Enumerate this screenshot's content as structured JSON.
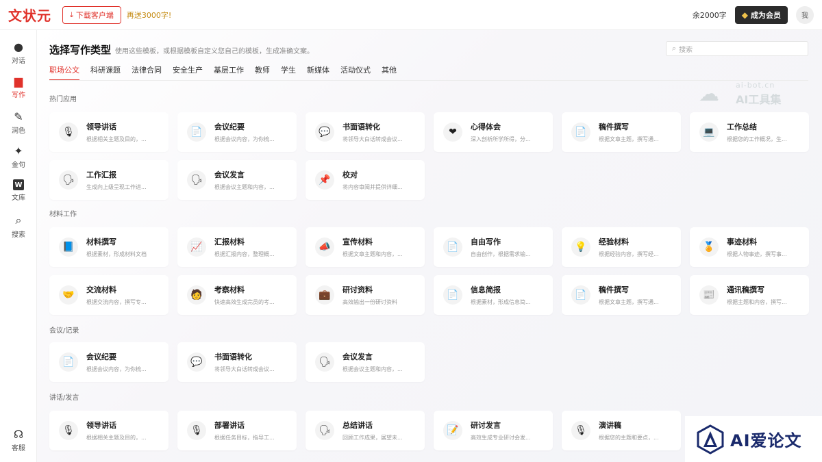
{
  "topbar": {
    "logo": "文状元",
    "download_label": "下载客户端",
    "promo": "再送3000字!",
    "balance": "余2000字",
    "vip_label": "成为会员",
    "avatar": "我"
  },
  "sidebar": [
    {
      "label": "对话",
      "icon": "chat-icon"
    },
    {
      "label": "写作",
      "icon": "document-icon",
      "active": true
    },
    {
      "label": "润色",
      "icon": "tools-icon"
    },
    {
      "label": "金句",
      "icon": "sparkle-icon"
    },
    {
      "label": "文库",
      "icon": "library-icon"
    },
    {
      "label": "搜索",
      "icon": "search-icon"
    },
    {
      "label": "客服",
      "icon": "headset-icon"
    }
  ],
  "page": {
    "title": "选择写作类型",
    "subtitle": "使用这些模板，或根据模板自定义您自己的模板，生成准确文案。",
    "search_placeholder": "搜索"
  },
  "tabs": [
    "职场公文",
    "科研课题",
    "法律合同",
    "安全生产",
    "基层工作",
    "教师",
    "学生",
    "新媒体",
    "活动仪式",
    "其他"
  ],
  "watermark": {
    "small": "ai-bot.cn",
    "big": "AI工具集"
  },
  "sections": [
    {
      "title": "热门应用",
      "cards": [
        {
          "name": "领导讲话",
          "desc": "根据相关主题及目的，...",
          "icon": "🎙"
        },
        {
          "name": "会议纪要",
          "desc": "根据会议内容，为你梳...",
          "icon": "📄"
        },
        {
          "name": "书面语转化",
          "desc": "将领导大白话转成会议...",
          "icon": "💬"
        },
        {
          "name": "心得体会",
          "desc": "深入剖析所学所得，分...",
          "icon": "❤"
        },
        {
          "name": "稿件撰写",
          "desc": "根据文章主题，撰写通...",
          "icon": "📄"
        },
        {
          "name": "工作总结",
          "desc": "根据您的工作概况，生...",
          "icon": "💻"
        },
        {
          "name": "工作汇报",
          "desc": "生成向上级呈现工作进...",
          "icon": "🗣"
        },
        {
          "name": "会议发言",
          "desc": "根据会议主题和内容，...",
          "icon": "🗣"
        },
        {
          "name": "校对",
          "desc": "将内容审阅并提供详细...",
          "icon": "📌"
        }
      ]
    },
    {
      "title": "材料工作",
      "cards": [
        {
          "name": "材料撰写",
          "desc": "根据素材，形成材料文档",
          "icon": "📘"
        },
        {
          "name": "汇报材料",
          "desc": "根据汇报内容，整理概...",
          "icon": "📈"
        },
        {
          "name": "宣传材料",
          "desc": "根据文章主题和内容，...",
          "icon": "📣"
        },
        {
          "name": "自由写作",
          "desc": "自由创作，根据需求输...",
          "icon": "📄"
        },
        {
          "name": "经验材料",
          "desc": "根据经验内容，撰写经...",
          "icon": "💡"
        },
        {
          "name": "事迹材料",
          "desc": "根据人物事迹，撰写事...",
          "icon": "🏅"
        },
        {
          "name": "交流材料",
          "desc": "根据交流内容，撰写专...",
          "icon": "🤝"
        },
        {
          "name": "考察材料",
          "desc": "快速高效生成完员的考...",
          "icon": "🧑"
        },
        {
          "name": "研讨资料",
          "desc": "高效输出一份研讨资料",
          "icon": "💼"
        },
        {
          "name": "信息简报",
          "desc": "根据素材，形成信息简...",
          "icon": "📄"
        },
        {
          "name": "稿件撰写",
          "desc": "根据文章主题，撰写通...",
          "icon": "📄"
        },
        {
          "name": "通讯稿撰写",
          "desc": "根据主题和内容，撰写...",
          "icon": "📰"
        }
      ]
    },
    {
      "title": "会议/记录",
      "cards": [
        {
          "name": "会议纪要",
          "desc": "根据会议内容，为你梳...",
          "icon": "📄"
        },
        {
          "name": "书面语转化",
          "desc": "将领导大白话转成会议...",
          "icon": "💬"
        },
        {
          "name": "会议发言",
          "desc": "根据会议主题和内容，...",
          "icon": "🗣"
        }
      ]
    },
    {
      "title": "讲话/发言",
      "cards": [
        {
          "name": "领导讲话",
          "desc": "根据相关主题及目的，...",
          "icon": "🎙"
        },
        {
          "name": "部署讲话",
          "desc": "根据任务目标，指导工...",
          "icon": "🎙"
        },
        {
          "name": "总结讲话",
          "desc": "回顾工作成果，展望未...",
          "icon": "🗣"
        },
        {
          "name": "研讨发言",
          "desc": "高效生成专业研讨会发...",
          "icon": "📝"
        },
        {
          "name": "演讲稿",
          "desc": "根据您的主题和要点，...",
          "icon": "🎙"
        }
      ]
    }
  ],
  "brand": {
    "text": "AI爱论文"
  }
}
